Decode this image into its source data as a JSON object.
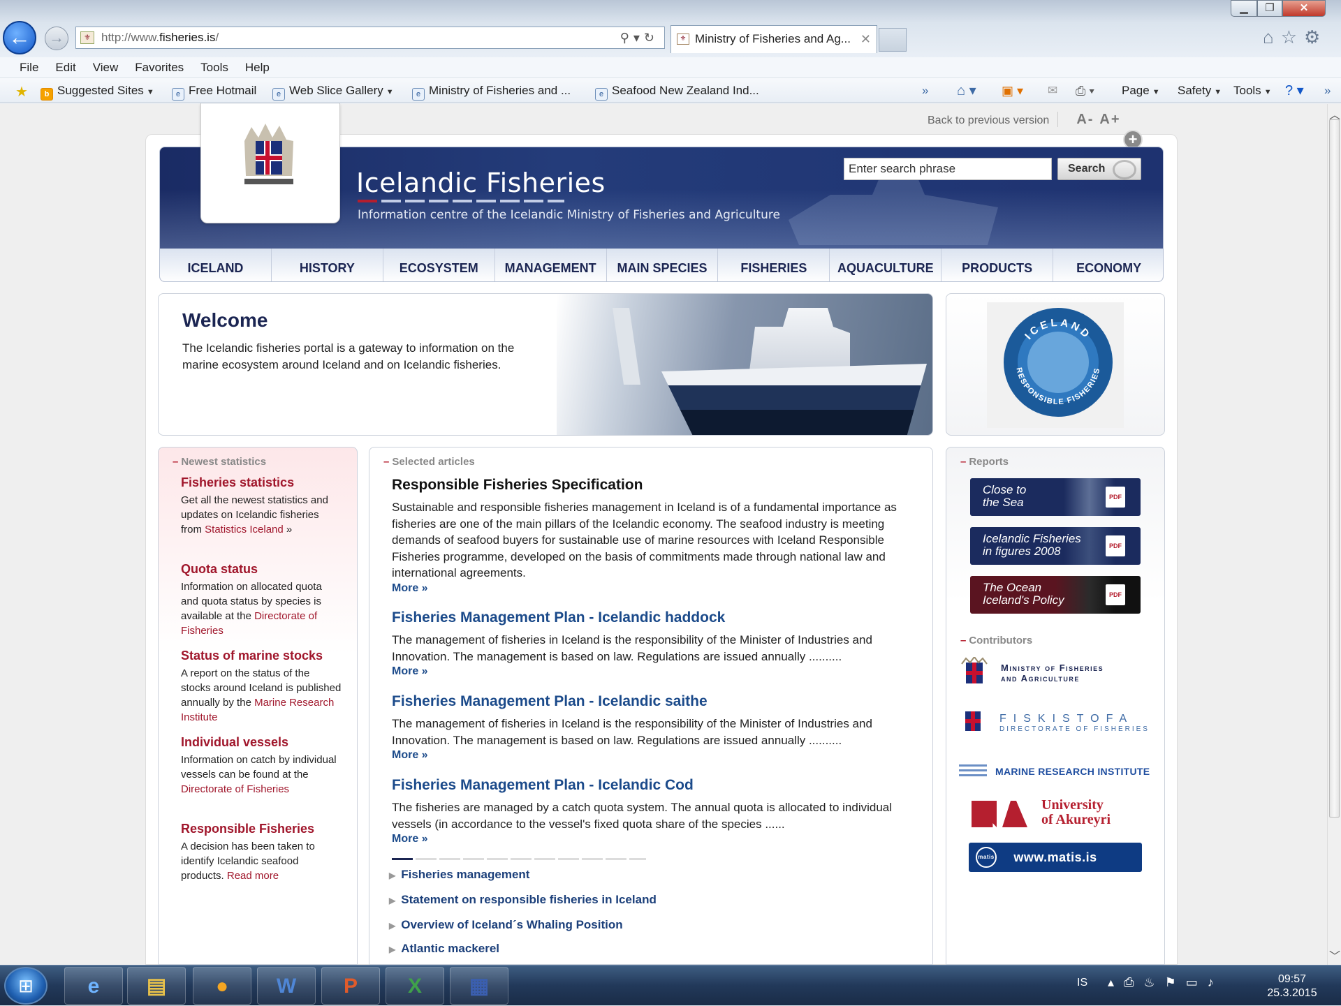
{
  "browser": {
    "address_url_prefix": "http://www.",
    "address_domain": "fisheries.is",
    "address_url_suffix": "/",
    "tab_title": "Ministry of Fisheries and Ag...",
    "menu": [
      "File",
      "Edit",
      "View",
      "Favorites",
      "Tools",
      "Help"
    ],
    "favorites": [
      {
        "label": "Suggested Sites"
      },
      {
        "label": "Free Hotmail"
      },
      {
        "label": "Web Slice Gallery"
      },
      {
        "label": "Ministry of Fisheries and ..."
      },
      {
        "label": "Seafood New Zealand Ind..."
      }
    ],
    "command_bar": {
      "page": "Page",
      "safety": "Safety",
      "tools": "Tools"
    }
  },
  "page": {
    "back_link": "Back to previous version",
    "font_smaller": "A-",
    "font_larger": "A+",
    "site_title": "Icelandic Fisheries",
    "site_subtitle": "Information centre of the Icelandic Ministry of Fisheries and Agriculture",
    "search_placeholder": "Enter search phrase",
    "search_button": "Search",
    "nav": [
      "ICELAND",
      "HISTORY",
      "ECOSYSTEM",
      "MANAGEMENT",
      "MAIN SPECIES",
      "FISHERIES",
      "AQUACULTURE",
      "PRODUCTS",
      "ECONOMY"
    ],
    "welcome": {
      "title": "Welcome",
      "text": "The Icelandic fisheries portal is a gateway to information on the marine ecosystem around Iceland and on Icelandic fisheries."
    },
    "badge": {
      "top": "ICELAND",
      "bottom": "RESPONSIBLE FISHERIES"
    },
    "newest_statistics": {
      "heading": "Newest statistics",
      "items": [
        {
          "title": "Fisheries statistics",
          "text": "Get all the newest statistics and updates on Icelandic fisheries from",
          "link": "Statistics Iceland",
          "suffix": " »"
        },
        {
          "title": "Quota status",
          "text": "Information on allocated quota and quota status by species is available at the",
          "link": "Directorate of Fisheries",
          "suffix": ""
        },
        {
          "title": "Status of marine stocks",
          "text": "A report on the status of the stocks around Iceland is published annually by the",
          "link": "Marine Research Institute",
          "suffix": ""
        },
        {
          "title": "Individual vessels",
          "text": "Information on catch by individual vessels can be found at the",
          "link": "Directorate of Fisheries",
          "suffix": ""
        },
        {
          "title": "Responsible Fisheries",
          "text": "A decision has been taken to identify Icelandic seafood products.",
          "link": "Read more",
          "suffix": ""
        }
      ]
    },
    "selected_articles": {
      "heading": "Selected articles",
      "more_label": "More »",
      "articles": [
        {
          "title": "Responsible Fisheries Specification",
          "text": "Sustainable and responsible fisheries management in Iceland is of a fundamental importance as fisheries are one of the main pillars of the Icelandic economy. The seafood industry is meeting demands of seafood buyers for sustainable use of marine resources with Iceland Responsible Fisheries programme, developed on the basis of commitments made through national law and international agreements."
        },
        {
          "title": "Fisheries Management Plan - Icelandic haddock",
          "text": "The management of fisheries in Iceland is the responsibility of the Minister of Industries and Innovation. The management is based on law. Regulations are issued annually .........."
        },
        {
          "title": "Fisheries Management Plan - Icelandic saithe",
          "text": "The management of fisheries in Iceland is the responsibility of the Minister of Industries and Innovation. The management is based on law. Regulations are issued annually .........."
        },
        {
          "title": "Fisheries Management Plan - Icelandic Cod",
          "text": "The fisheries are managed by a catch quota system. The annual quota is allocated to individual vessels (in accordance to the vessel's fixed quota share of the species ......"
        }
      ],
      "links": [
        "Fisheries management",
        "Statement on responsible fisheries in Iceland",
        "Overview of Iceland´s Whaling Position",
        "Atlantic mackerel"
      ]
    },
    "reports": {
      "heading": "Reports",
      "items": [
        {
          "line1": "Close to",
          "line2": "the Sea"
        },
        {
          "line1": "Icelandic Fisheries",
          "line2": "in figures 2008"
        },
        {
          "line1": "The Ocean",
          "line2": "Iceland's Policy"
        }
      ],
      "pdf_label": "PDF"
    },
    "contributors": {
      "heading": "Contributors",
      "ministry_line1": "Ministry of Fisheries",
      "ministry_line2": "and Agriculture",
      "fiskistofa": "FISKISTOFA",
      "fiskistofa_sub": "DIRECTORATE OF FISHERIES",
      "mri": "MARINE RESEARCH INSTITUTE",
      "unak_line1": "University",
      "unak_line2": "of Akureyri",
      "matis": "www.matis.is",
      "matis_logo": "matis"
    }
  },
  "taskbar": {
    "language": "IS",
    "time": "09:57",
    "date": "25.3.2015"
  },
  "colors": {
    "nav_dark": "#1b2552",
    "accent_red": "#a0162b",
    "link_blue": "#1b4a8a"
  }
}
